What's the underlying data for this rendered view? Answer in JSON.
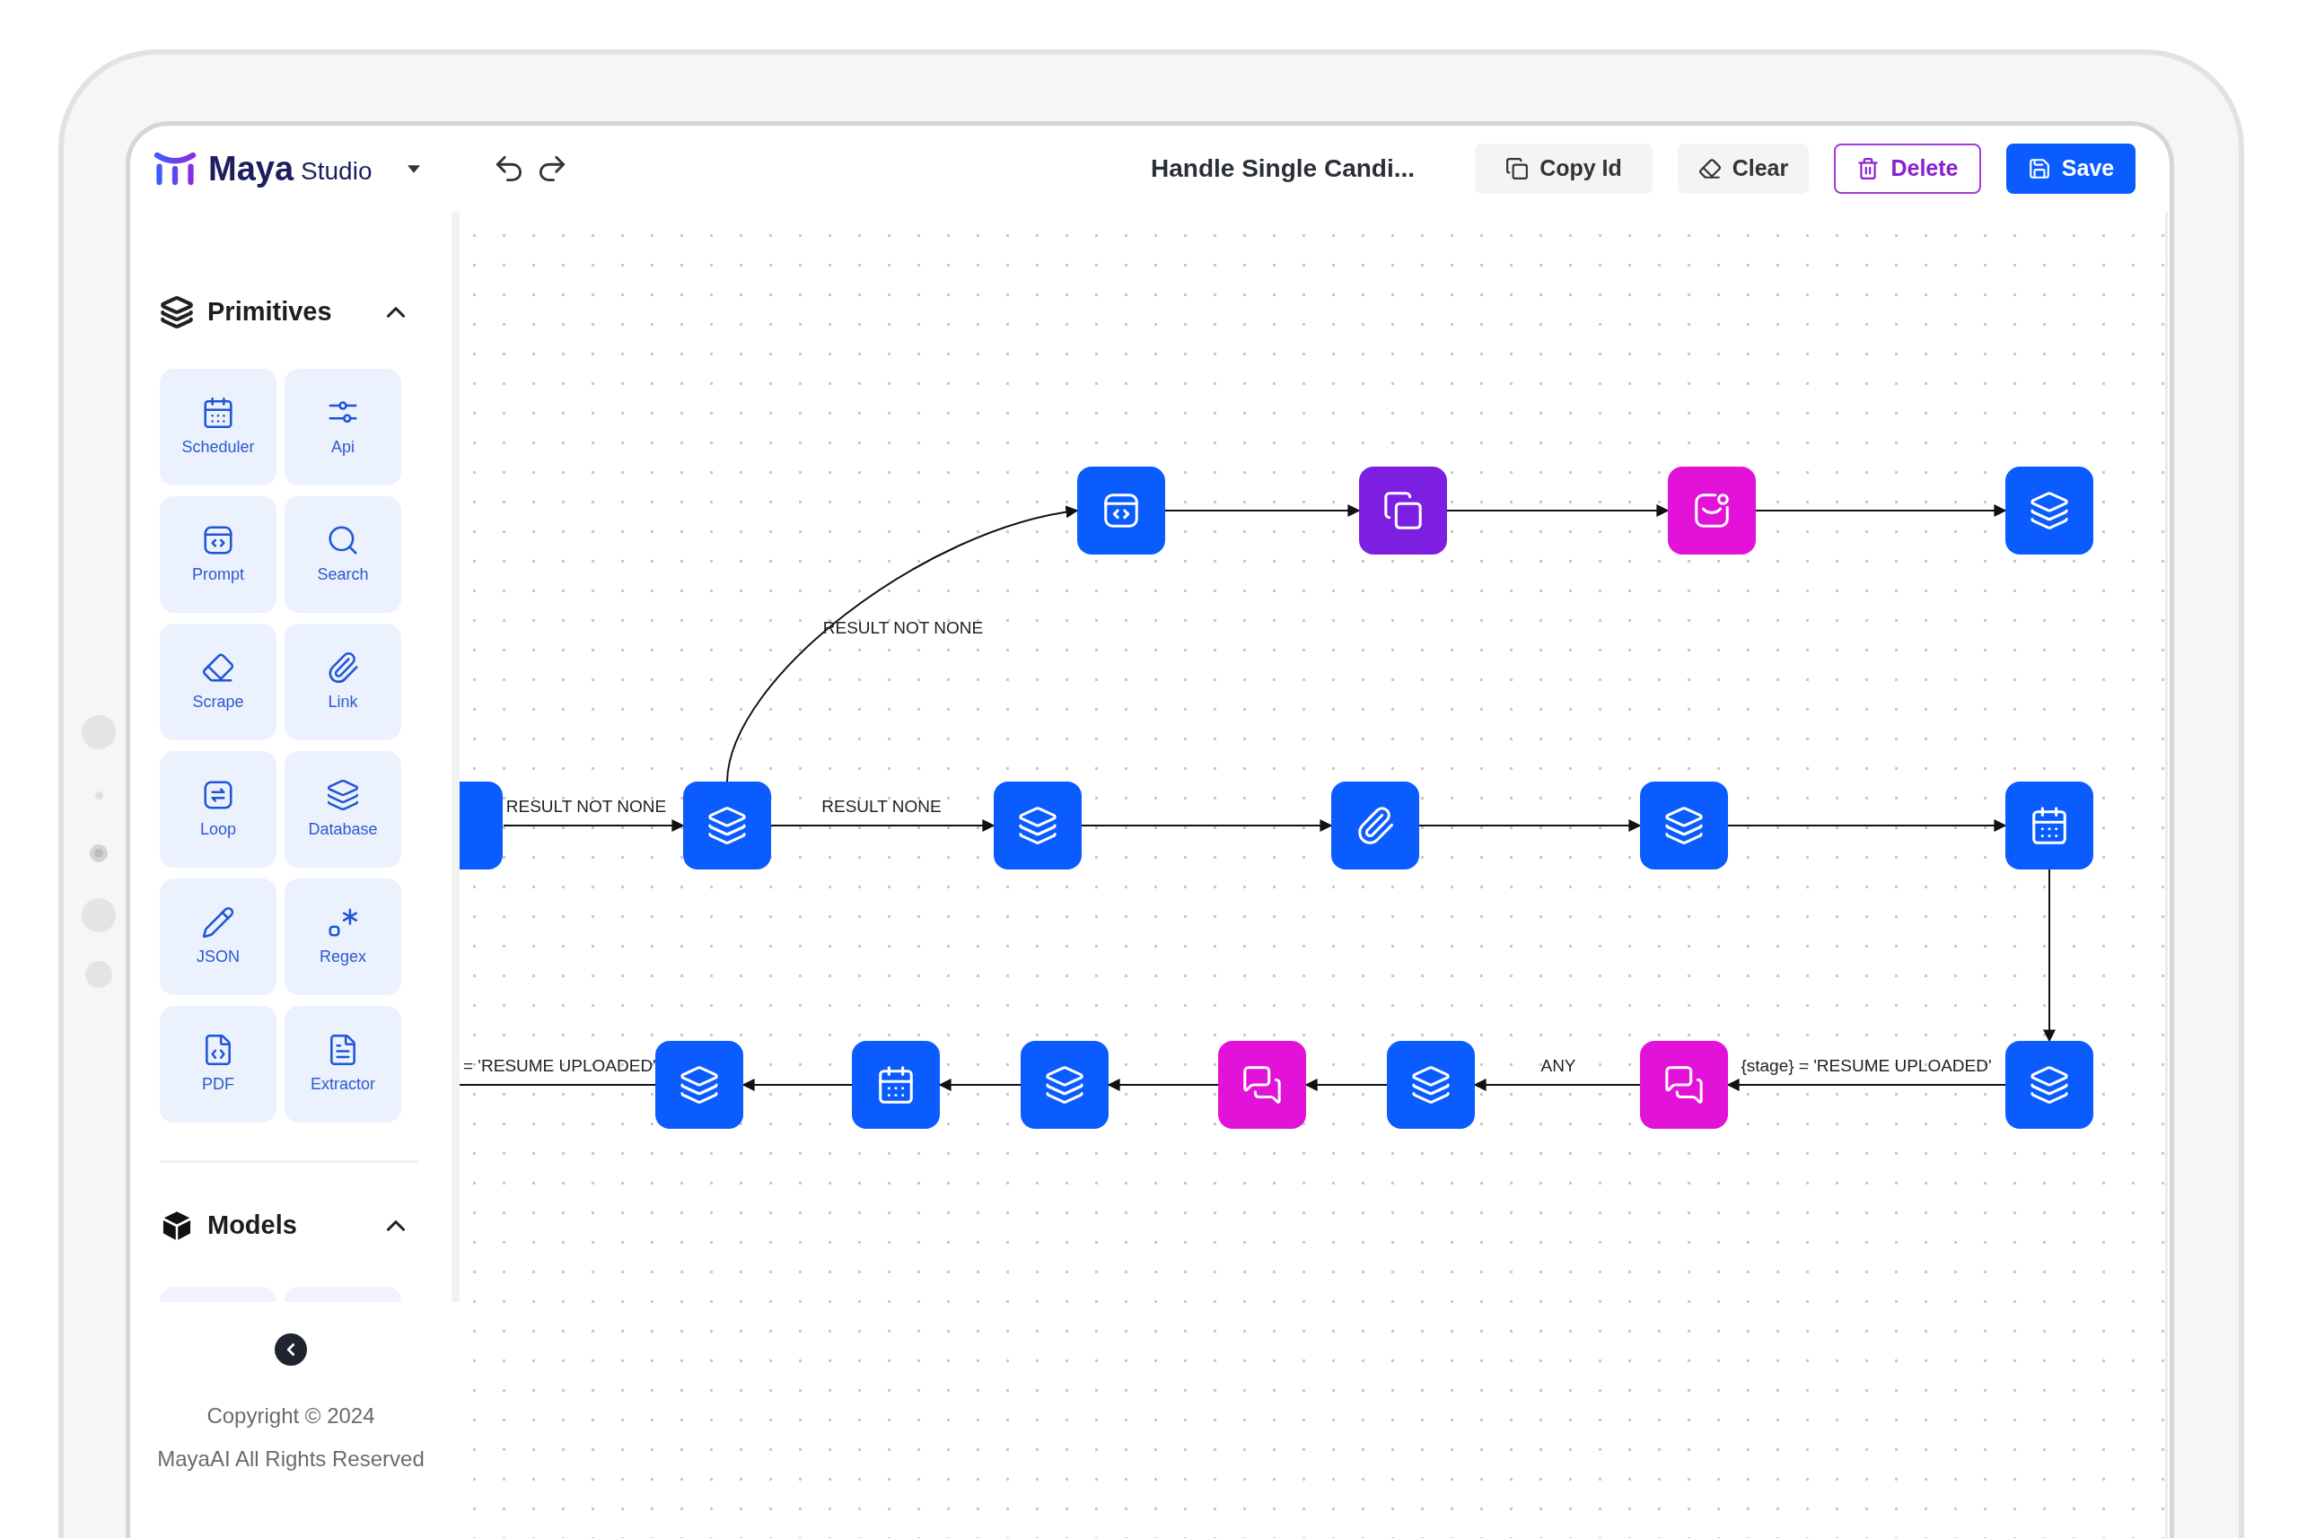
{
  "app": {
    "brand": "Maya",
    "brand_suffix": "Studio"
  },
  "header": {
    "title": "Handle Single Candi...",
    "buttons": [
      {
        "label": "Copy Id",
        "kind": "secondary"
      },
      {
        "label": "Clear",
        "kind": "secondary"
      },
      {
        "label": "Delete",
        "kind": "outline"
      },
      {
        "label": "Save",
        "kind": "primary"
      }
    ]
  },
  "sidebar": {
    "sections": [
      {
        "title": "Primitives",
        "expanded": true,
        "items": [
          {
            "label": "Scheduler"
          },
          {
            "label": "Api"
          },
          {
            "label": "Prompt"
          },
          {
            "label": "Search"
          },
          {
            "label": "Scrape"
          },
          {
            "label": "Link"
          },
          {
            "label": "Loop"
          },
          {
            "label": "Database"
          },
          {
            "label": "JSON"
          },
          {
            "label": "Regex"
          },
          {
            "label": "PDF"
          },
          {
            "label": "Extractor"
          }
        ]
      },
      {
        "title": "Models",
        "expanded": true
      }
    ],
    "footer": [
      "Copyright © 2024",
      "MayaAI All Rights Reserved"
    ]
  },
  "canvas": {
    "nodes": [
      {
        "color": "#0a5cff"
      },
      {
        "color": "#7c1fe0"
      },
      {
        "color": "#e312d9"
      },
      {
        "color": "#0a5cff"
      },
      {
        "color": "#0a5cff"
      },
      {
        "color": "#0a5cff"
      },
      {
        "color": "#0a5cff"
      },
      {
        "color": "#0a5cff"
      },
      {
        "color": "#0a5cff"
      },
      {
        "color": "#0a5cff"
      },
      {
        "color": "#0a5cff"
      },
      {
        "color": "#0a5cff"
      },
      {
        "color": "#0a5cff"
      },
      {
        "color": "#e312d9"
      },
      {
        "color": "#0a5cff"
      },
      {
        "color": "#e312d9"
      },
      {
        "color": "#0a5cff"
      }
    ],
    "edges": [
      {
        "label": "RESULT NOT NONE"
      },
      {
        "label": "RESULT NOT NONE"
      },
      {
        "label": "RESULT NONE"
      },
      {
        "label": "= 'RESUME UPLOADED'"
      },
      {
        "label": "ANY"
      },
      {
        "label": "{stage} = 'RESUME UPLOADED'"
      }
    ]
  }
}
